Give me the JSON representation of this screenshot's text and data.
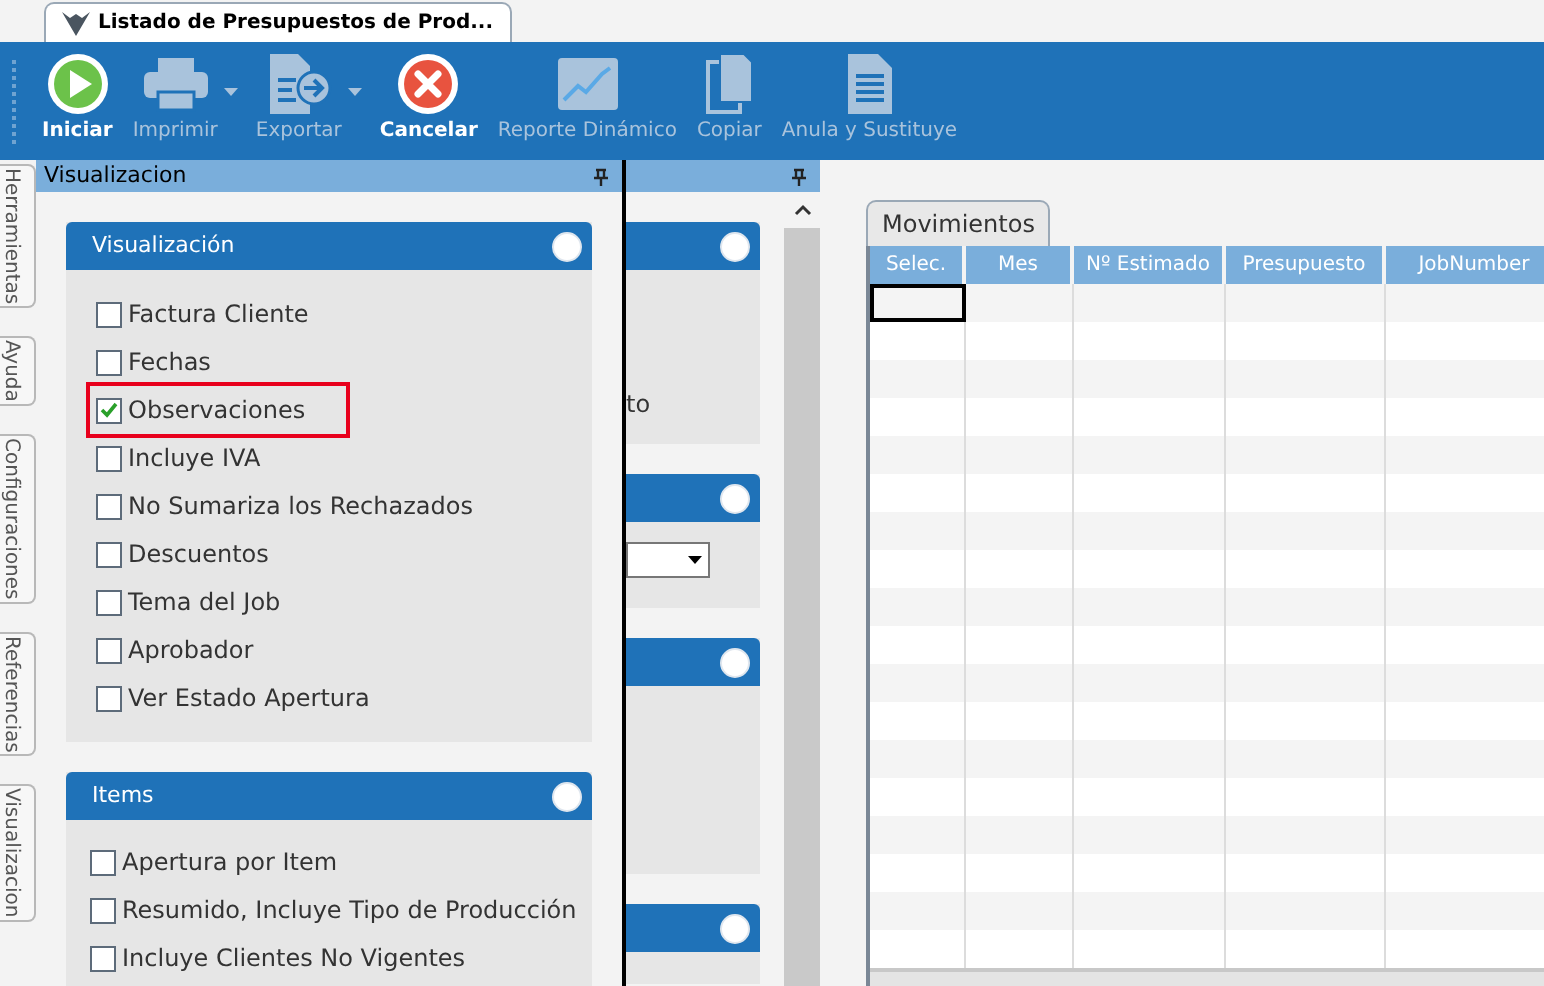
{
  "document_tab": {
    "title": "Listado de Presupuestos de Prod..."
  },
  "toolbar": [
    {
      "label": "Iniciar",
      "kind": "play",
      "disabled": false,
      "dropdown": false
    },
    {
      "label": "Imprimir",
      "kind": "printer",
      "disabled": true,
      "dropdown": true
    },
    {
      "label": "Exportar",
      "kind": "export",
      "disabled": true,
      "dropdown": true
    },
    {
      "label": "Cancelar",
      "kind": "cancel",
      "disabled": false,
      "dropdown": false
    },
    {
      "label": "Reporte Dinámico",
      "kind": "chart",
      "disabled": true,
      "dropdown": false
    },
    {
      "label": "Copiar",
      "kind": "copy",
      "disabled": true,
      "dropdown": false
    },
    {
      "label": "Anula y Sustituye",
      "kind": "document",
      "disabled": true,
      "dropdown": false
    }
  ],
  "side_tabs": [
    "Herramientas",
    "Ayuda",
    "Configuraciones",
    "Referencias",
    "Visualizacion"
  ],
  "panel": {
    "title": "Visualizacion",
    "groups": [
      {
        "title": "Visualización",
        "options": [
          {
            "label": "Factura Cliente",
            "checked": false,
            "highlighted": false
          },
          {
            "label": "Fechas",
            "checked": false,
            "highlighted": false
          },
          {
            "label": "Observaciones",
            "checked": true,
            "highlighted": true
          },
          {
            "label": "Incluye IVA",
            "checked": false,
            "highlighted": false
          },
          {
            "label": "No Sumariza los Rechazados",
            "checked": false,
            "highlighted": false
          },
          {
            "label": "Descuentos",
            "checked": false,
            "highlighted": false
          },
          {
            "label": "Tema del Job",
            "checked": false,
            "highlighted": false
          },
          {
            "label": "Aprobador",
            "checked": false,
            "highlighted": false
          },
          {
            "label": "Ver Estado Apertura",
            "checked": false,
            "highlighted": false
          }
        ]
      },
      {
        "title": "Items",
        "options": [
          {
            "label": "Apertura por Item",
            "checked": false,
            "highlighted": false
          },
          {
            "label": "Resumido, Incluye Tipo de Producción",
            "checked": false,
            "highlighted": false
          },
          {
            "label": "Incluye Clientes No Vigentes",
            "checked": false,
            "highlighted": false
          }
        ]
      }
    ]
  },
  "background_panel": {
    "text": "to"
  },
  "grid": {
    "tab": "Movimientos",
    "columns": [
      "Selec.",
      "Mes",
      "Nº Estimado",
      "Presupuesto",
      "JobNumber"
    ]
  }
}
